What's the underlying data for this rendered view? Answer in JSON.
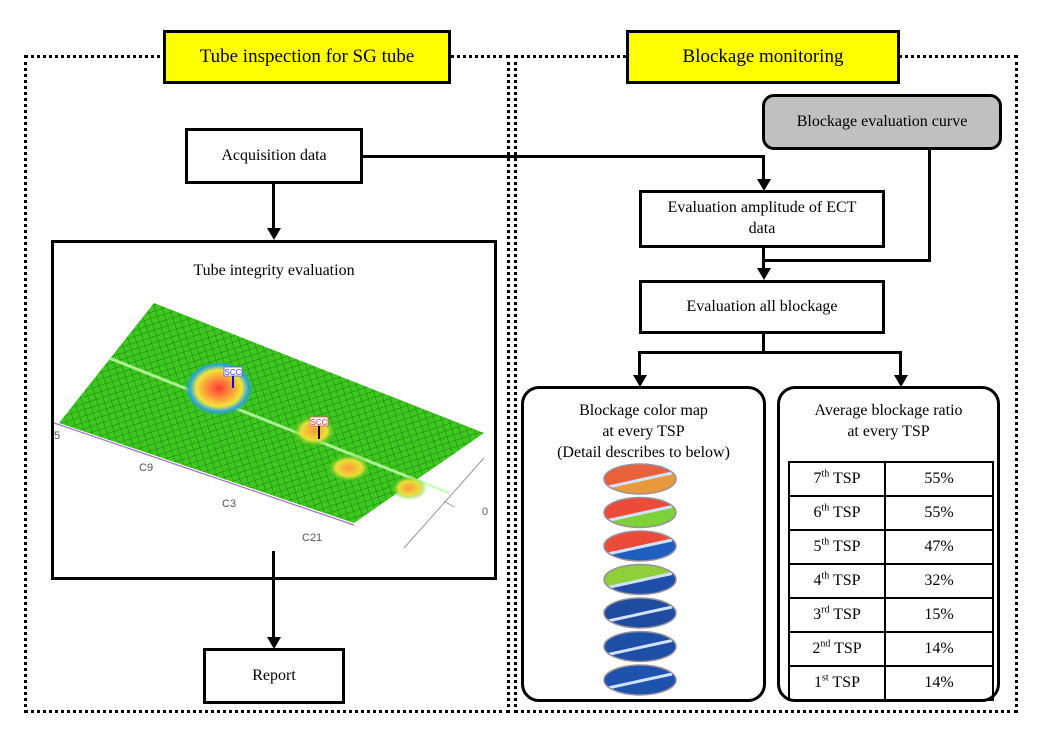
{
  "left_panel": {
    "title": "Tube inspection for SG tube",
    "acquisition": "Acquisition data",
    "integrity": {
      "title": "Tube integrity evaluation",
      "plot_axis_labels": [
        "5",
        "C9",
        "C3",
        "C21",
        "0"
      ],
      "markers": [
        "SCC",
        "SCC"
      ]
    },
    "report": "Report"
  },
  "right_panel": {
    "title": "Blockage monitoring",
    "curve": "Blockage evaluation curve",
    "amplitude": "Evaluation amplitude of ECT data",
    "all_blockage": "Evaluation all blockage",
    "color_map": {
      "line1": "Blockage color map",
      "line2": "at every TSP",
      "line3": "(Detail describes to below)",
      "discs": [
        {
          "tsp": "7th",
          "top": "#e8613a",
          "bottom": "#e89a3a"
        },
        {
          "tsp": "6th",
          "top": "#ec4b3a",
          "bottom": "#7fd13a"
        },
        {
          "tsp": "5th",
          "top": "#ec4b3a",
          "bottom": "#1f5fbf"
        },
        {
          "tsp": "4th",
          "top": "#8fd03a",
          "bottom": "#1f4fa8"
        },
        {
          "tsp": "3rd",
          "top": "#1f4c9e",
          "bottom": "#1f4c9e"
        },
        {
          "tsp": "2nd",
          "top": "#1e4fa6",
          "bottom": "#1e4fa6"
        },
        {
          "tsp": "1st",
          "top": "#1f52ac",
          "bottom": "#1f52ac"
        }
      ]
    },
    "ratio": {
      "line1": "Average blockage ratio",
      "line2": "at every TSP",
      "rows": [
        {
          "num": "7",
          "suffix": "th",
          "unit": "TSP",
          "value": "55%"
        },
        {
          "num": "6",
          "suffix": "th",
          "unit": "TSP",
          "value": "55%"
        },
        {
          "num": "5",
          "suffix": "th",
          "unit": "TSP",
          "value": "47%"
        },
        {
          "num": "4",
          "suffix": "th",
          "unit": "TSP",
          "value": "32%"
        },
        {
          "num": "3",
          "suffix": "rd",
          "unit": "TSP",
          "value": "15%"
        },
        {
          "num": "2",
          "suffix": "nd",
          "unit": "TSP",
          "value": "14%"
        },
        {
          "num": "1",
          "suffix": "st",
          "unit": "TSP",
          "value": "14%"
        }
      ]
    }
  }
}
